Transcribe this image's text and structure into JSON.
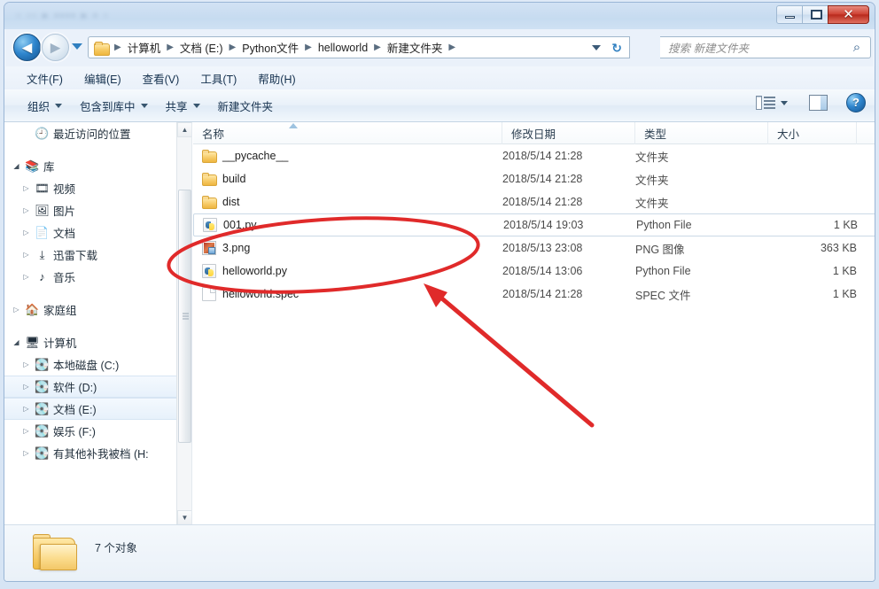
{
  "window": {
    "title_bar_ghost": "▫ ▫▫  ▸ ▪▪▪▪  ▸ ▪ ▫",
    "minimize_label": "—",
    "maximize_label": "❐",
    "close_label": "✕"
  },
  "nav": {
    "back_label": "◀",
    "forward_label": "▶",
    "recent_dropdown_label": "▾",
    "refresh_label": "↻",
    "address_caret_label": "▾",
    "breadcrumbs": [
      "计算机",
      "文档 (E:)",
      "Python文件",
      "helloworld",
      "新建文件夹"
    ],
    "separator": "▶"
  },
  "search": {
    "placeholder": "搜索 新建文件夹",
    "icon_label": "⌕"
  },
  "menubar": {
    "items": [
      {
        "label": "文件(F)"
      },
      {
        "label": "编辑(E)"
      },
      {
        "label": "查看(V)"
      },
      {
        "label": "工具(T)"
      },
      {
        "label": "帮助(H)"
      }
    ]
  },
  "commandbar": {
    "items": [
      {
        "label": "组织",
        "has_caret": true
      },
      {
        "label": "包含到库中",
        "has_caret": true
      },
      {
        "label": "共享",
        "has_caret": true
      },
      {
        "label": "新建文件夹",
        "has_caret": false
      }
    ],
    "view_caret_label": "▾",
    "help_label": "?"
  },
  "sidebar": {
    "items": [
      {
        "label": "最近访问的位置",
        "icon": "recent-places-icon",
        "glyph": "🕘",
        "indent": true,
        "expander": "",
        "selected": false
      },
      {
        "label": "库",
        "icon": "libraries-icon",
        "glyph": "📚",
        "indent": false,
        "expander": "◢",
        "selected": false
      },
      {
        "label": "视频",
        "icon": "videos-icon",
        "glyph": "🎞",
        "indent": true,
        "expander": "▷",
        "selected": false
      },
      {
        "label": "图片",
        "icon": "pictures-icon",
        "glyph": "🖼",
        "indent": true,
        "expander": "▷",
        "selected": false
      },
      {
        "label": "文档",
        "icon": "documents-icon",
        "glyph": "📄",
        "indent": true,
        "expander": "▷",
        "selected": false
      },
      {
        "label": "迅雷下载",
        "icon": "downloads-icon",
        "glyph": "⤓",
        "indent": true,
        "expander": "▷",
        "selected": false
      },
      {
        "label": "音乐",
        "icon": "music-icon",
        "glyph": "♪",
        "indent": true,
        "expander": "▷",
        "selected": false
      },
      {
        "label": "家庭组",
        "icon": "homegroup-icon",
        "glyph": "🏠",
        "indent": false,
        "expander": "▷",
        "selected": false
      },
      {
        "label": "计算机",
        "icon": "computer-icon",
        "glyph": "🖥",
        "indent": false,
        "expander": "◢",
        "selected": false
      },
      {
        "label": "本地磁盘 (C:)",
        "icon": "system-drive-icon",
        "glyph": "💽",
        "indent": true,
        "expander": "▷",
        "selected": false
      },
      {
        "label": "软件 (D:)",
        "icon": "drive-icon",
        "glyph": "💽",
        "indent": true,
        "expander": "▷",
        "selected": true
      },
      {
        "label": "文档 (E:)",
        "icon": "drive-icon",
        "glyph": "💽",
        "indent": true,
        "expander": "▷",
        "selected": true
      },
      {
        "label": "娱乐 (F:)",
        "icon": "drive-icon",
        "glyph": "💽",
        "indent": true,
        "expander": "▷",
        "selected": false
      },
      {
        "label": "有其他补我被档 (H:",
        "icon": "drive-icon",
        "glyph": "💽",
        "indent": true,
        "expander": "▷",
        "selected": false
      }
    ],
    "scroll_up_label": "▲",
    "scroll_down_label": "▼"
  },
  "filelist": {
    "columns": [
      {
        "label": "名称"
      },
      {
        "label": "修改日期"
      },
      {
        "label": "类型"
      },
      {
        "label": "大小"
      }
    ],
    "sort_column": "名称",
    "sort_direction": "asc",
    "rows": [
      {
        "name": "__pycache__",
        "modified": "2018/5/14 21:28",
        "type": "文件夹",
        "size": "",
        "icon": "folder",
        "selected": false
      },
      {
        "name": "build",
        "modified": "2018/5/14 21:28",
        "type": "文件夹",
        "size": "",
        "icon": "folder",
        "selected": false
      },
      {
        "name": "dist",
        "modified": "2018/5/14 21:28",
        "type": "文件夹",
        "size": "",
        "icon": "folder",
        "selected": false
      },
      {
        "name": "001.py",
        "modified": "2018/5/14 19:03",
        "type": "Python File",
        "size": "1 KB",
        "icon": "py",
        "selected": true
      },
      {
        "name": "3.png",
        "modified": "2018/5/13 23:08",
        "type": "PNG 图像",
        "size": "363 KB",
        "icon": "png",
        "selected": false
      },
      {
        "name": "helloworld.py",
        "modified": "2018/5/14 13:06",
        "type": "Python File",
        "size": "1 KB",
        "icon": "py",
        "selected": false
      },
      {
        "name": "helloworld.spec",
        "modified": "2018/5/14 21:28",
        "type": "SPEC 文件",
        "size": "1 KB",
        "icon": "doc",
        "selected": false
      }
    ]
  },
  "statusbar": {
    "text": "7 个对象"
  },
  "annotations": {
    "color": "#e02a2a",
    "ellipse_label": "highlight-ellipse",
    "arrow_label": "pointer-arrow"
  }
}
